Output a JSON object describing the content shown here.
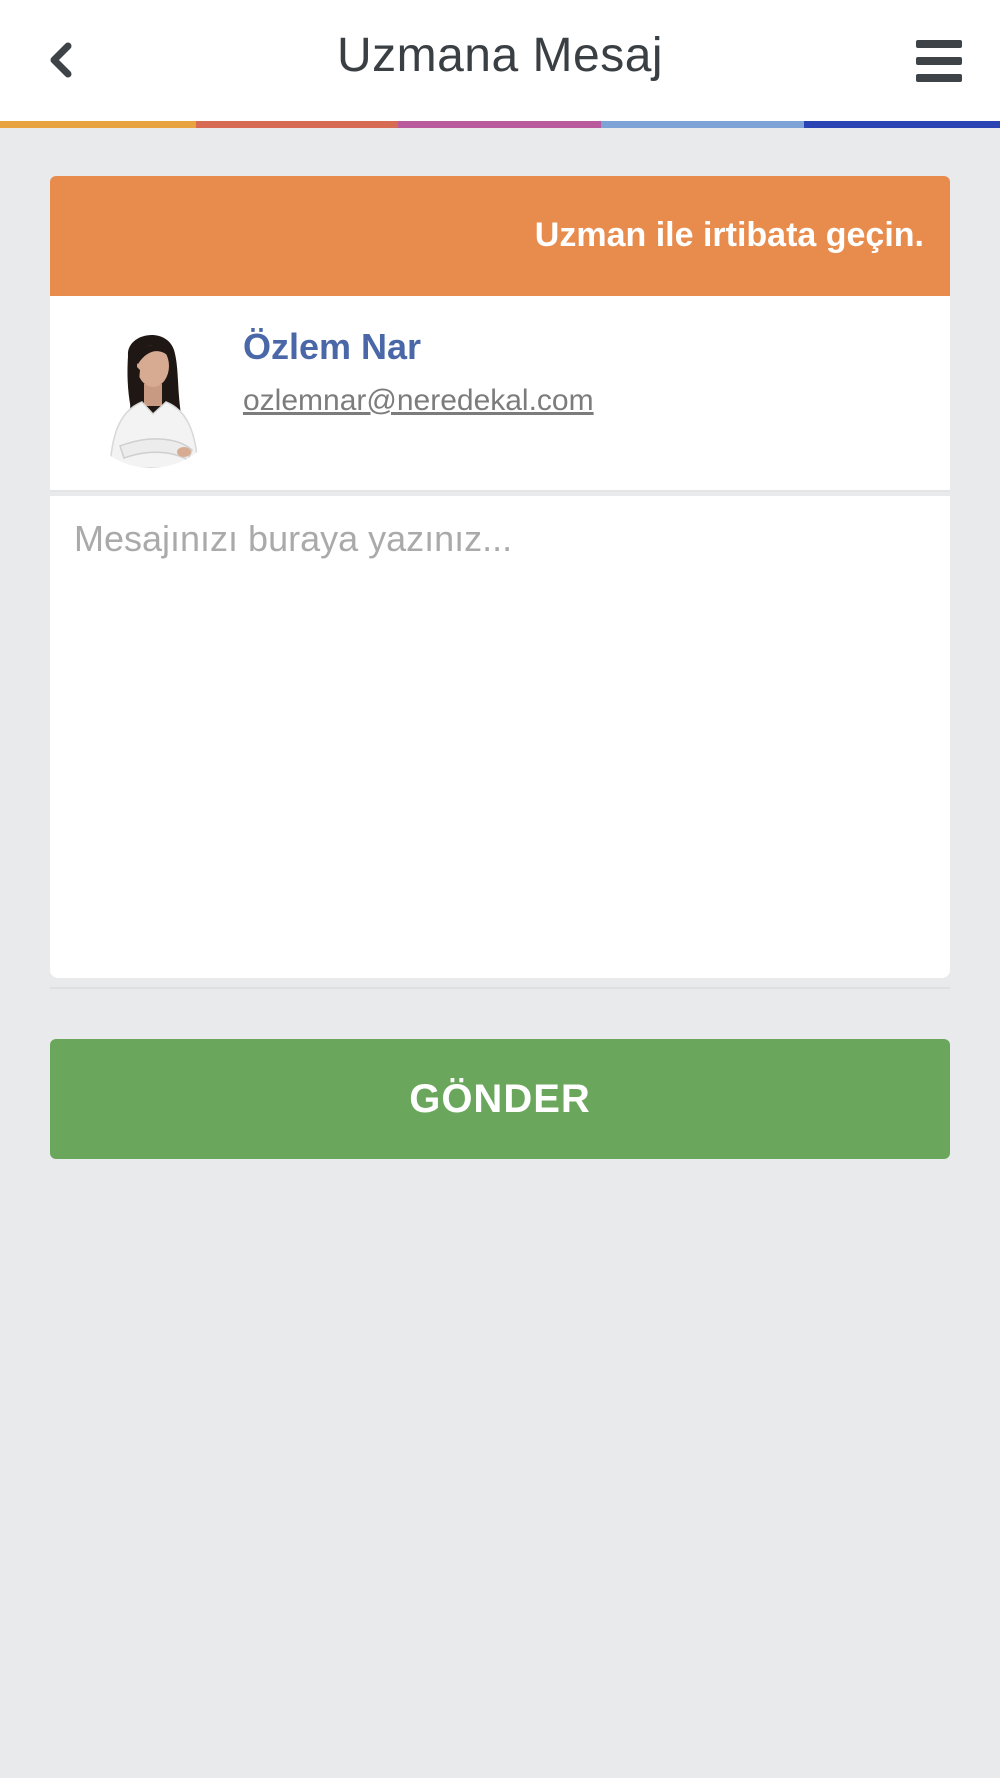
{
  "header": {
    "title": "Uzmana Mesaj",
    "back_icon": "chevron-left-icon",
    "menu_icon": "hamburger-menu-icon"
  },
  "color_bar": [
    "#e8a23f",
    "#d66a52",
    "#b85a9c",
    "#7ea3d6",
    "#2a45b3"
  ],
  "card": {
    "heading": "Uzman ile irtibata geçin."
  },
  "expert": {
    "name": "Özlem Nar",
    "email": "ozlemnar@neredekal.com"
  },
  "message": {
    "placeholder": "Mesajınızı buraya yazınız...",
    "value": ""
  },
  "send_button": {
    "label": "GÖNDER"
  },
  "colors": {
    "accent_orange": "#e88c4e",
    "name_blue": "#4a68a8",
    "send_green": "#6aa75c",
    "background": "#e9eaec"
  }
}
